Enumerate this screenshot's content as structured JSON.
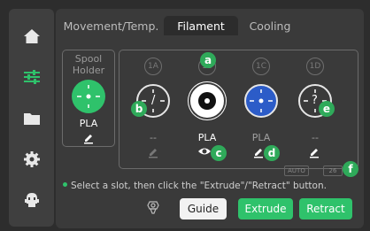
{
  "sidebar": {
    "items": [
      {
        "icon": "home-icon"
      },
      {
        "icon": "controls-icon",
        "active": true
      },
      {
        "icon": "folder-icon"
      },
      {
        "icon": "settings-icon"
      },
      {
        "icon": "robot-icon"
      }
    ],
    "accent": "#2fc26b"
  },
  "tabs": [
    {
      "label": "Movement/Temp."
    },
    {
      "label": "Filament",
      "active": true
    },
    {
      "label": "Cooling"
    }
  ],
  "spool_holder": {
    "title": "Spool Holder",
    "filament": "PLA",
    "color": "#2fc26b"
  },
  "slots": [
    {
      "badge": "1A",
      "filament": "--",
      "color": "#eeeeee",
      "marker": "b",
      "symbol": "/"
    },
    {
      "badge": "1B",
      "filament": "PLA",
      "color": "#ffffff",
      "marker": "a"
    },
    {
      "badge": "1C",
      "filament": "PLA",
      "color": "#2c5cc8",
      "marker": "d"
    },
    {
      "badge": "1D",
      "filament": "--",
      "color": "#eeeeee",
      "marker": "e",
      "symbol": "?"
    }
  ],
  "markers": {
    "c": "c",
    "f": "f"
  },
  "chips": {
    "auto": "AUTO",
    "temp": "26"
  },
  "hint": "Select a slot, then click the \"Extrude\"/\"Retract\" button.",
  "buttons": {
    "guide": "Guide",
    "extrude": "Extrude",
    "retract": "Retract"
  }
}
